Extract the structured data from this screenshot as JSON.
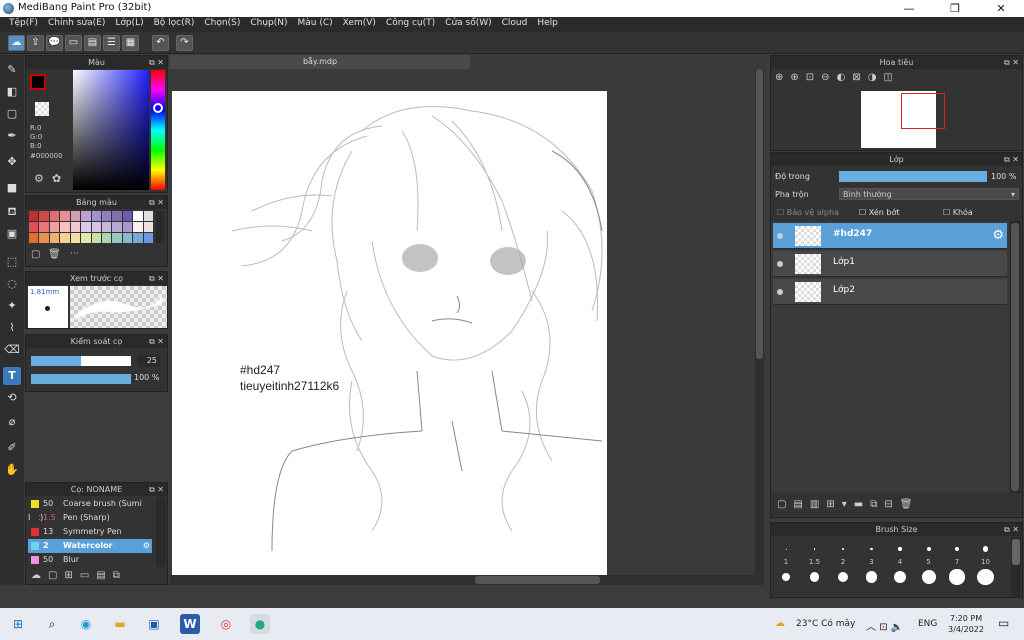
{
  "window": {
    "title": "MediBang Paint Pro (32bit)",
    "min": "—",
    "max": "❐",
    "close": "✕"
  },
  "menu": [
    "Tệp(F)",
    "Chỉnh sửa(E)",
    "Lớp(L)",
    "Bộ lọc(R)",
    "Chọn(S)",
    "Chụp(N)",
    "Màu (C)",
    "Xem(V)",
    "Công cụ(T)",
    "Cửa sổ(W)",
    "Cloud",
    "Help"
  ],
  "color_panel": {
    "title": "Màu",
    "r": "R:0",
    "g": "G:0",
    "b": "B:0",
    "hex": "#000000",
    "primary": "#000000",
    "hue_pos": 0.28
  },
  "palette_panel": {
    "title": "Bảng màu",
    "more": "···"
  },
  "brush_preview": {
    "title": "Xem trước cọ",
    "size": "1.81mm"
  },
  "brush_control": {
    "title": "Kiểm soát cọ",
    "size_value": "25",
    "opacity_value": "100 %",
    "size_level": 0.5,
    "opacity_level": 1.0
  },
  "brush_list": {
    "title": "Cọ: NONAME",
    "items": [
      {
        "size": "50",
        "name": "Coarse brush (Sumi Ink)",
        "color": "#f0e020"
      },
      {
        "size": "1.5",
        "name": "Pen (Sharp)",
        "color": "#303030"
      },
      {
        "size": "13",
        "name": "Symmetry Pen",
        "color": "#e03030"
      },
      {
        "size": "2",
        "name": "Watercolor",
        "color": "#70d0f0",
        "selected": true
      },
      {
        "size": "50",
        "name": "Blur",
        "color": "#f090e0"
      }
    ]
  },
  "document": {
    "tab": "bẫy.mdp",
    "text_line1": "#hd247",
    "text_line2": "tieuyeitinh27112k6"
  },
  "navigator": {
    "title": "Hoa tiêu"
  },
  "layers": {
    "title": "Lớp",
    "opacity_label": "Độ trong",
    "opacity_value": "100 %",
    "opacity_level": 1.0,
    "blend_label": "Pha trộn",
    "blend_value": "Bình thường",
    "protect_alpha": "Bảo vệ alpha",
    "clip": "Xén bớt",
    "lock": "Khóa",
    "items": [
      {
        "name": "#hd247",
        "selected": true
      },
      {
        "name": "Lớp1",
        "selected": false
      },
      {
        "name": "Lớp2",
        "selected": false
      }
    ]
  },
  "brush_size": {
    "title": "Brush Size",
    "labels": [
      "1",
      "1.5",
      "2",
      "3",
      "4",
      "5",
      "7",
      "10"
    ]
  },
  "taskbar": {
    "weather": "23°C  Có mây",
    "lang": "ENG",
    "time": "7:20 PM",
    "date": "3/4/2022"
  }
}
